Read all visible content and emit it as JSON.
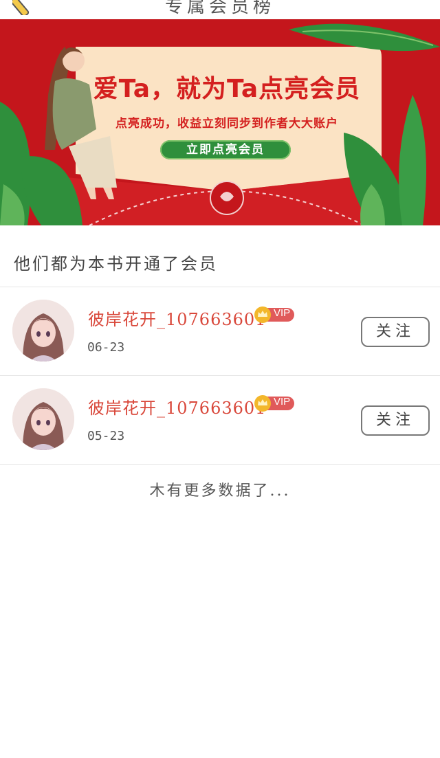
{
  "header": {
    "title": "专属会员榜",
    "back_icon": "pencil-back-icon"
  },
  "banner": {
    "headline": "爱Ta，就为Ta点亮会员",
    "subtext": "点亮成功，收益立刻同步到作者大大账户",
    "cta_label": "立即点亮会员",
    "colors": {
      "background": "#c4161c",
      "card": "#fbe3c4",
      "leaf": "#2f8f3c",
      "text": "#d4201f"
    }
  },
  "section": {
    "title": "他们都为本书开通了会员"
  },
  "members": [
    {
      "username": "彼岸花开_107663601",
      "badge": "VIP",
      "date": "06-23",
      "follow_label": "关注"
    },
    {
      "username": "彼岸花开_107663601",
      "badge": "VIP",
      "date": "05-23",
      "follow_label": "关注"
    }
  ],
  "footer": {
    "no_more_text": "木有更多数据了..."
  }
}
